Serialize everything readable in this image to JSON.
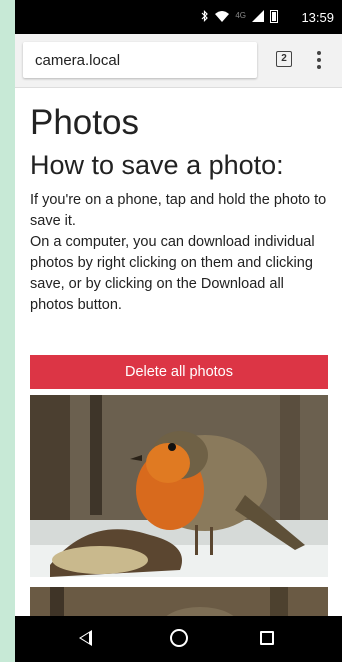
{
  "status_bar": {
    "time": "13:59",
    "network": "4G",
    "icons": [
      "bluetooth-icon",
      "wifi-icon",
      "signal-icon",
      "battery-icon"
    ]
  },
  "browser": {
    "url": "camera.local",
    "tab_count": "2",
    "icons": [
      "tabs-icon",
      "overflow-menu-icon"
    ]
  },
  "page": {
    "title": "Photos",
    "subtitle": "How to save a photo:",
    "instructions": [
      "If you're on a phone, tap and hold the photo to save it.",
      "On a computer, you can download individual photos by right clicking on them and clicking save, or by clicking on the Download all photos button."
    ],
    "delete_button": "Delete all photos"
  },
  "photos": [
    {
      "subject": "robin on bird feeder"
    },
    {
      "subject": "robin on bird feeder"
    }
  ],
  "nav_bar": {
    "icons": [
      "back-icon",
      "home-icon",
      "recents-icon"
    ]
  },
  "colors": {
    "accent": "#dc3545",
    "background": "#c7e9d6",
    "status_bar": "#000000"
  }
}
